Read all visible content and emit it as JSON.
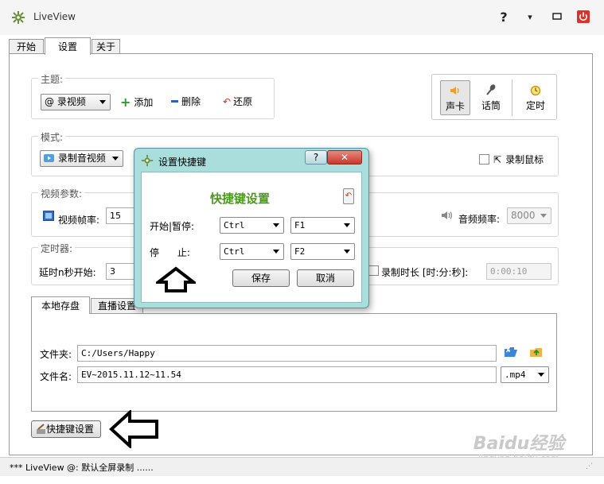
{
  "app": {
    "title": "LiveView"
  },
  "window_buttons": {
    "help": "?",
    "menu": "▾"
  },
  "tabs": [
    "开始",
    "设置",
    "关于"
  ],
  "theme": {
    "legend": "主题:",
    "selected": "录视频",
    "add_label": "添加",
    "delete_label": "删除",
    "restore_label": "还原"
  },
  "toolbar_right": {
    "soundcard_label": "声卡",
    "mic_label": "话筒",
    "timer_label": "定时"
  },
  "mode": {
    "legend": "模式:",
    "selected": "录制音视频",
    "record_mouse_label": "录制鼠标",
    "record_mouse_checked": false
  },
  "video": {
    "legend": "视频参数:",
    "fps_label": "视频帧率:",
    "fps_value": "15",
    "audio_rate_label": "音频频率:",
    "audio_rate_value": "8000"
  },
  "timer": {
    "legend": "定时器:",
    "delay_label": "延时n秒开始:",
    "delay_value": "3",
    "duration_label": "录制时长 [时:分:秒]:",
    "duration_checked": false,
    "duration_value": "0:00:10"
  },
  "storage": {
    "tabs": [
      "本地存盘",
      "直播设置"
    ],
    "folder_label": "文件夹:",
    "folder_value": "C:/Users/Happy",
    "filename_label": "文件名:",
    "filename_value": "EV~2015.11.12~11.54",
    "format_value": ".mp4"
  },
  "hotkey_button": {
    "label": "快捷键设置"
  },
  "status": {
    "text": "*** LiveView @: 默认全屏录制 ......"
  },
  "dialog": {
    "title": "设置快捷键",
    "heading": "快捷键设置",
    "start_pause_label": "开始|暂停:",
    "start_pause_modifier": "Ctrl",
    "start_pause_key": "F1",
    "stop_label": "停      止:",
    "stop_modifier": "Ctrl",
    "stop_key": "F2",
    "save_label": "保存",
    "cancel_label": "取消",
    "help_glyph": "?",
    "close_glyph": "✕"
  },
  "watermark": {
    "brand": "Baidu经验",
    "url": "jingyan.baidu.com"
  },
  "colors": {
    "heading_green": "#4a9a1c",
    "close_red": "#d9332c",
    "dialog_frame": "#a9dedd"
  }
}
